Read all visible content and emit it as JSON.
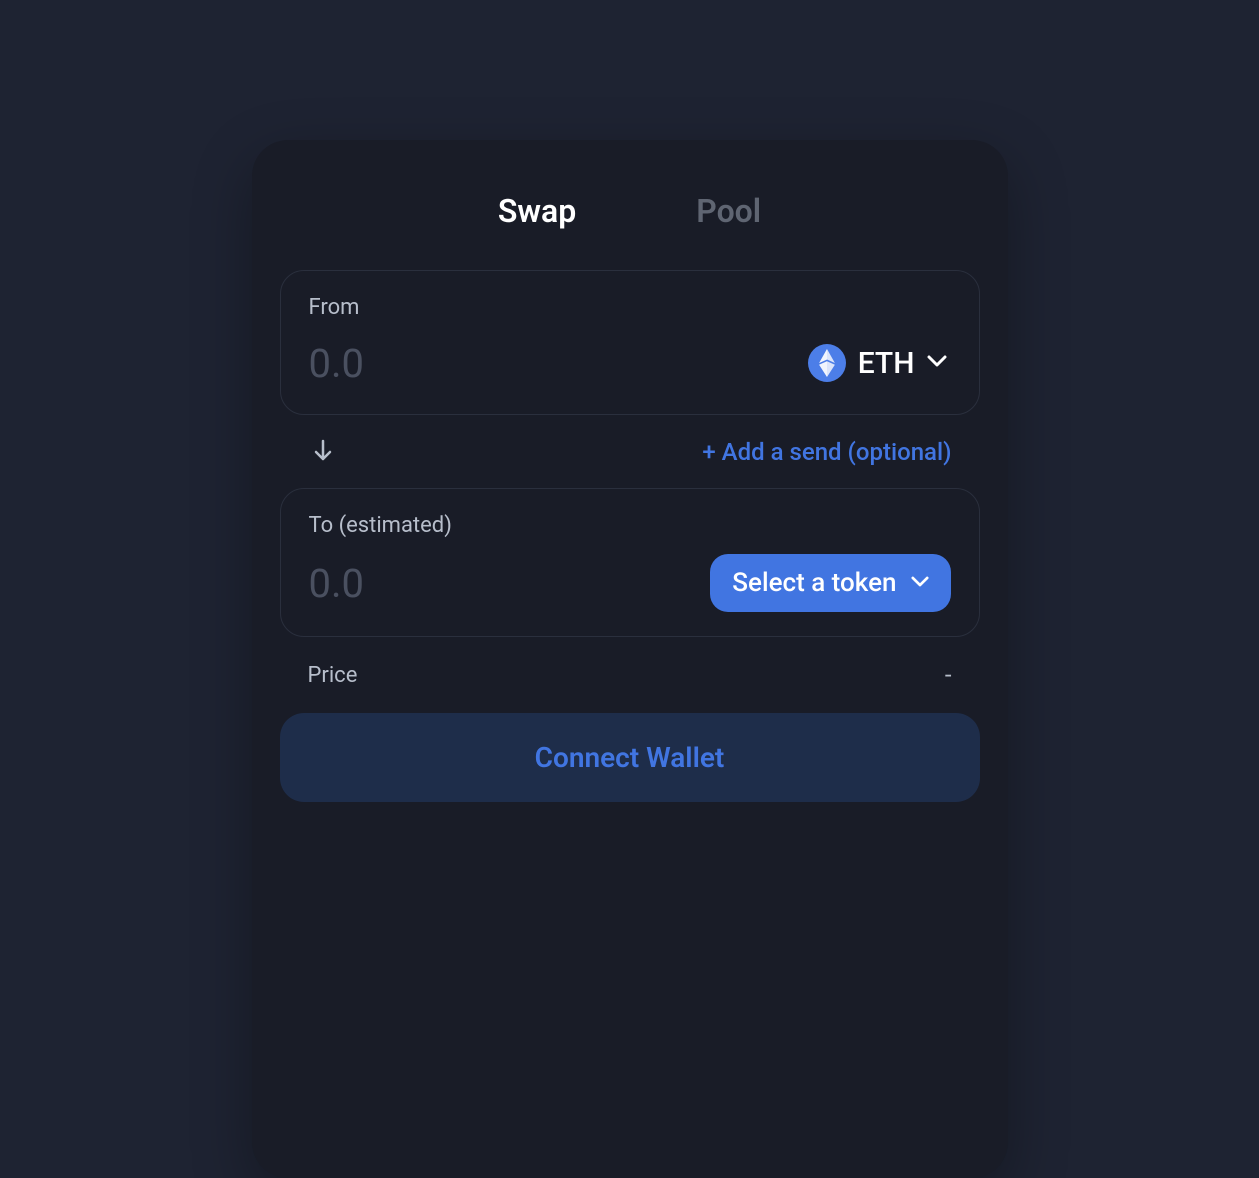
{
  "tabs": {
    "swap": "Swap",
    "pool": "Pool"
  },
  "from_panel": {
    "label": "From",
    "placeholder": "0.0",
    "value": "",
    "token_symbol": "ETH"
  },
  "middle": {
    "add_send_label": "+ Add a send (optional)"
  },
  "to_panel": {
    "label": "To (estimated)",
    "placeholder": "0.0",
    "value": "",
    "select_token_label": "Select a token"
  },
  "price": {
    "label": "Price",
    "value": "-"
  },
  "connect_button_label": "Connect Wallet"
}
